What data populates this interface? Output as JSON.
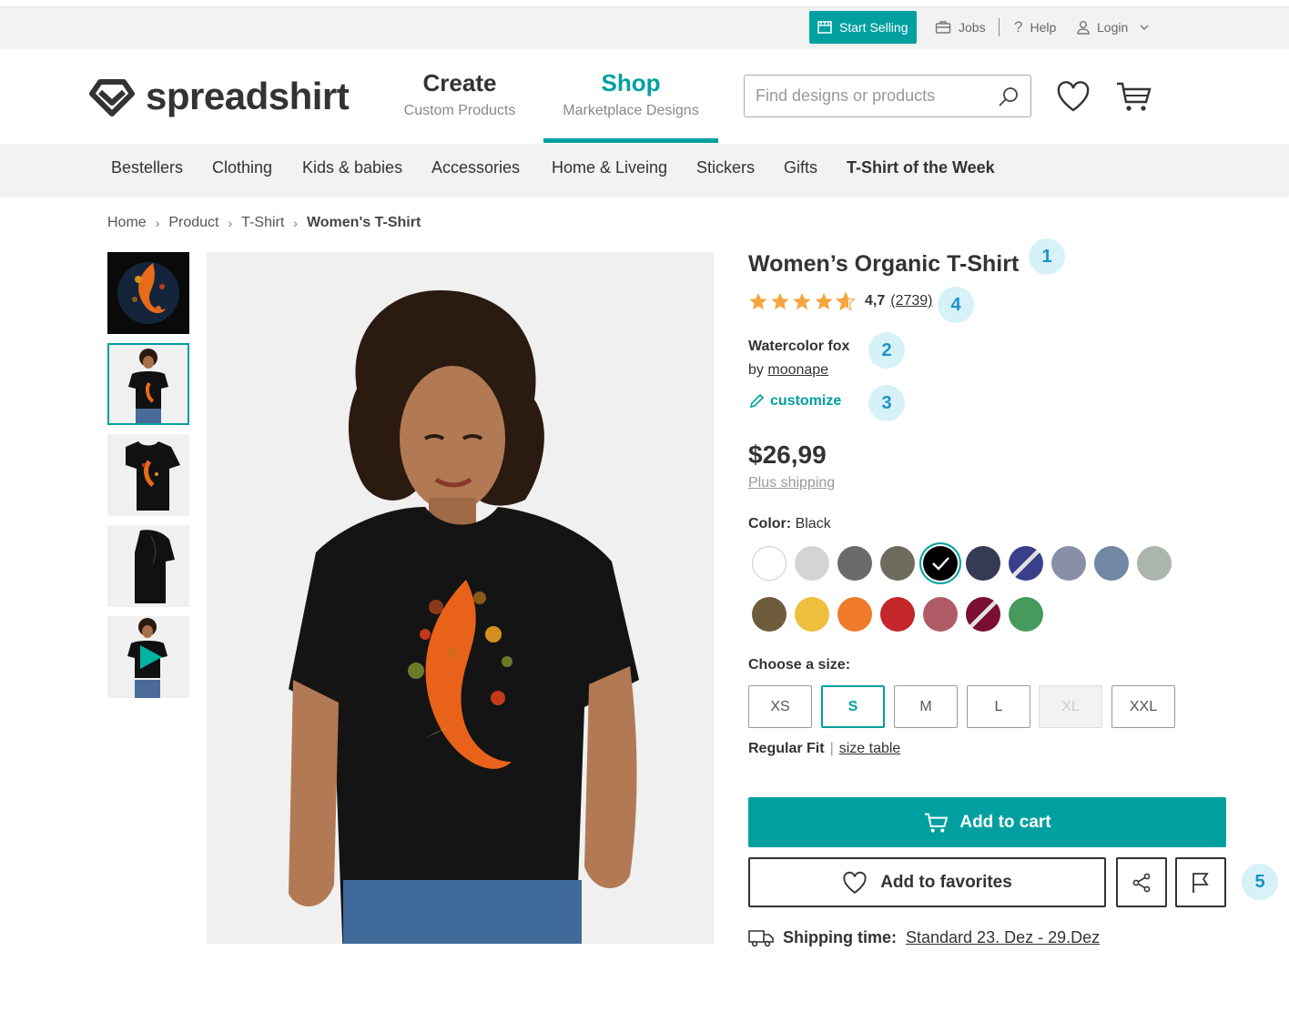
{
  "utility_bar": {
    "start_selling": "Start Selling",
    "jobs": "Jobs",
    "help": "Help",
    "login": "Login"
  },
  "header": {
    "logo_text": "spreadshirt",
    "create_title": "Create",
    "create_sub": "Custom Products",
    "shop_title": "Shop",
    "shop_sub": "Marketplace Designs",
    "search_placeholder": "Find designs or products"
  },
  "categories": [
    "Bestellers",
    "Clothing",
    "Kids & babies",
    "Accessories",
    "Home & Liveing",
    "Stickers",
    "Gifts",
    "T-Shirt of the Week"
  ],
  "breadcrumb": [
    "Home",
    "Product",
    "T-Shirt",
    "Women's T-Shirt"
  ],
  "product": {
    "title": "Women’s Organic T-Shirt",
    "rating_value": "4,7",
    "rating_count": "(2739)",
    "rating_stars": 4.7,
    "design_name": "Watercolor fox",
    "by_prefix": "by",
    "designer": "moonape",
    "customize": "customize",
    "price": "$26,99",
    "plus_shipping": "Plus shipping",
    "color_label": "Color:",
    "color_value": "Black",
    "colors": [
      "#ffffff",
      "#d4d4d4",
      "#6a6a6a",
      "#6e6a5e",
      "#000000",
      "#363a55",
      "#3a3f8a",
      "#8a8fa8",
      "#7088a4",
      "#aab5ac",
      "#6e5c3c",
      "#eebf3c",
      "#ee7a2a",
      "#c4262a",
      "#b05c66",
      "#7a0e34",
      "#479a5c"
    ],
    "size_label": "Choose a size:",
    "sizes": [
      "XS",
      "S",
      "M",
      "L",
      "XL",
      "XXL"
    ],
    "fit": "Regular Fit",
    "size_table": "size table",
    "add_to_cart": "Add to cart",
    "add_to_favorites": "Add to favorites",
    "shipping_label": "Shipping time:",
    "shipping_value": "Standard 23. Dez - 29.Dez"
  },
  "markers": [
    "1",
    "4",
    "2",
    "3",
    "5"
  ],
  "accent_color": "#00a0a0"
}
